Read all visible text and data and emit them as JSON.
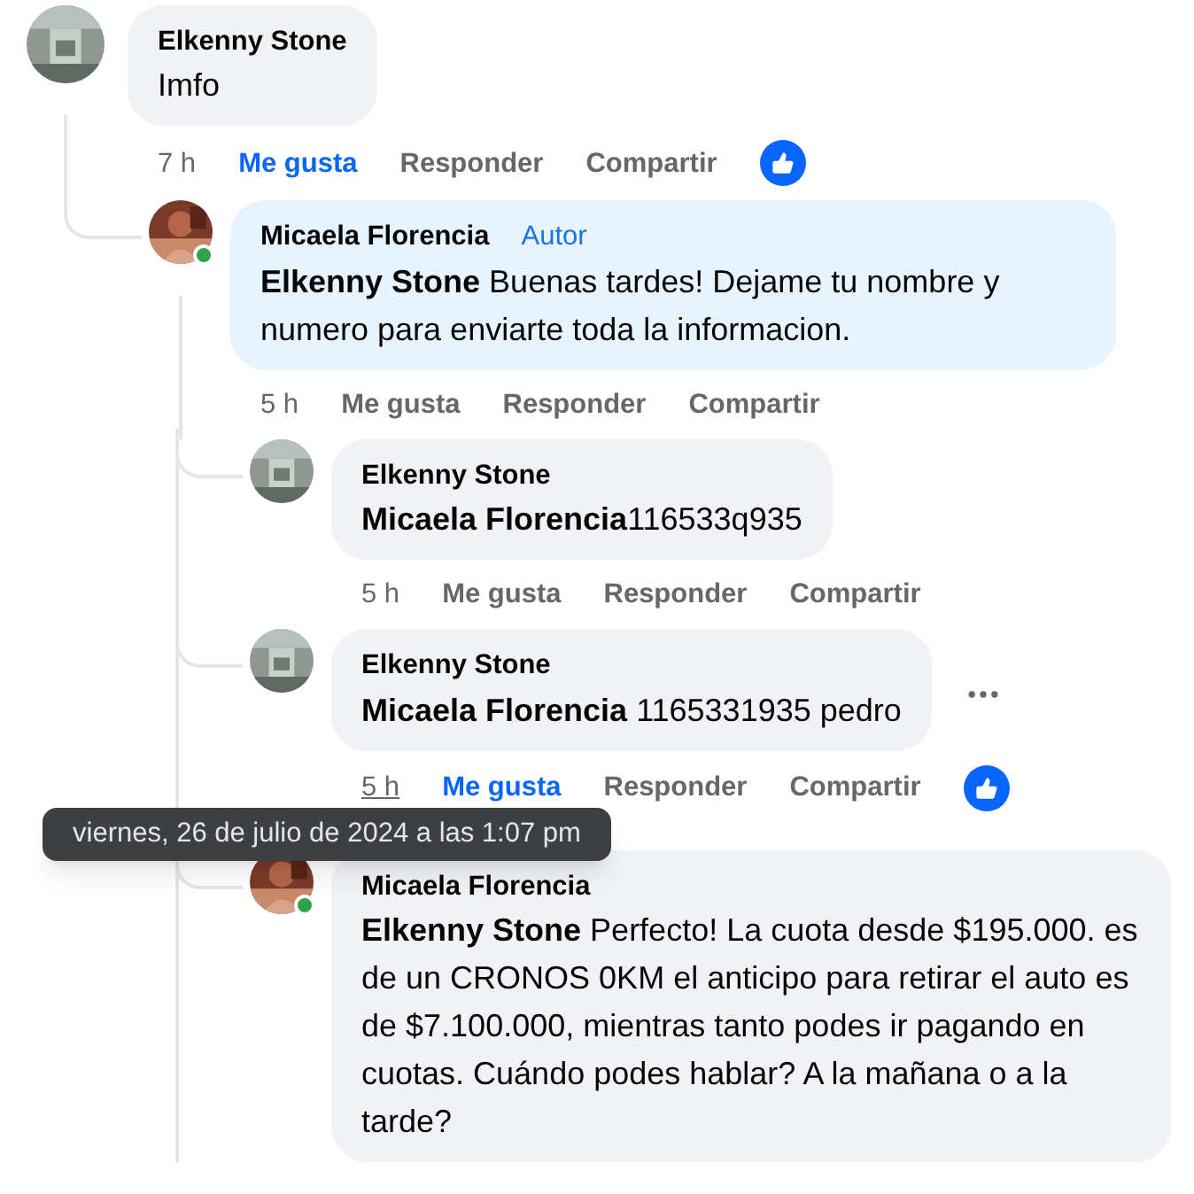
{
  "comments": [
    {
      "author": "Elkenny Stone",
      "text": "Imfo",
      "time": "7 h",
      "like_label": "Me gusta",
      "liked": true,
      "reply_label": "Responder",
      "share_label": "Compartir",
      "reacted": true,
      "children": [
        {
          "author": "Micaela Florencia",
          "author_badge": "Autor",
          "online": true,
          "highlighted": true,
          "mention": "Elkenny Stone",
          "text": "Buenas tardes! Dejame tu nombre y numero para enviarte toda la informacion.",
          "time": "5 h",
          "like_label": "Me gusta",
          "liked": false,
          "reply_label": "Responder",
          "share_label": "Compartir",
          "reacted": false,
          "children": [
            {
              "author": "Elkenny Stone",
              "mention": "Micaela Florencia",
              "text": "116533q935",
              "mention_gap": false,
              "time": "5 h",
              "like_label": "Me gusta",
              "liked": false,
              "reply_label": "Responder",
              "share_label": "Compartir",
              "reacted": false
            },
            {
              "author": "Elkenny Stone",
              "mention": "Micaela Florencia",
              "text": "1165331935 pedro",
              "mention_gap": true,
              "more": true,
              "time": "5 h",
              "time_hovered": true,
              "like_label": "Me gusta",
              "liked": true,
              "reply_label": "Responder",
              "share_label": "Compartir",
              "reacted": true
            },
            {
              "author": "Micaela Florencia",
              "online": true,
              "mention": "Elkenny Stone",
              "text": "Perfecto! La cuota desde $195.000. es de un CRONOS 0KM el anticipo para retirar el auto es de $7.100.000, mientras tanto podes ir pagando en cuotas. Cuándo podes hablar? A la mañana o a la tarde?"
            }
          ]
        }
      ]
    }
  ],
  "tooltip": {
    "text": "viernes, 26 de julio de 2024 a las 1:07 pm"
  }
}
